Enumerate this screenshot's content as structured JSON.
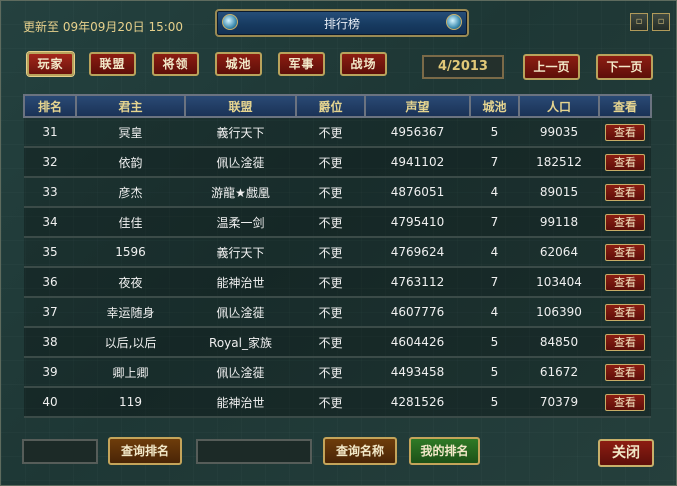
{
  "header": {
    "updated": "更新至 09年09月20日 15:00",
    "title": "排行榜"
  },
  "tabs": [
    {
      "label": "玩家"
    },
    {
      "label": "联盟"
    },
    {
      "label": "将领"
    },
    {
      "label": "城池"
    },
    {
      "label": "军事"
    },
    {
      "label": "战场"
    }
  ],
  "pagination": {
    "indicator": "4/2013",
    "prev_label": "上一页",
    "next_label": "下一页"
  },
  "table": {
    "columns": [
      "排名",
      "君主",
      "联盟",
      "爵位",
      "声望",
      "城池",
      "人口",
      "查看"
    ],
    "rows": [
      {
        "rank": "31",
        "lord": "冥皇",
        "alliance": "義行天下",
        "title": "不更",
        "prestige": "4956367",
        "cities": "5",
        "population": "99035",
        "view": "查看"
      },
      {
        "rank": "32",
        "lord": "依韵",
        "alliance": "佩亾淦蓰",
        "title": "不更",
        "prestige": "4941102",
        "cities": "7",
        "population": "182512",
        "view": "查看"
      },
      {
        "rank": "33",
        "lord": "彦杰",
        "alliance": "游龍★戲凰",
        "title": "不更",
        "prestige": "4876051",
        "cities": "4",
        "population": "89015",
        "view": "查看"
      },
      {
        "rank": "34",
        "lord": "佳佳",
        "alliance": "温柔一剑",
        "title": "不更",
        "prestige": "4795410",
        "cities": "7",
        "population": "99118",
        "view": "查看"
      },
      {
        "rank": "35",
        "lord": "1596",
        "alliance": "義行天下",
        "title": "不更",
        "prestige": "4769624",
        "cities": "4",
        "population": "62064",
        "view": "查看"
      },
      {
        "rank": "36",
        "lord": "夜夜",
        "alliance": "能神治世",
        "title": "不更",
        "prestige": "4763112",
        "cities": "7",
        "population": "103404",
        "view": "查看"
      },
      {
        "rank": "37",
        "lord": "幸运随身",
        "alliance": "佩亾淦蓰",
        "title": "不更",
        "prestige": "4607776",
        "cities": "4",
        "population": "106390",
        "view": "查看"
      },
      {
        "rank": "38",
        "lord": "以后,以后",
        "alliance": "Royal_家族",
        "title": "不更",
        "prestige": "4604426",
        "cities": "5",
        "population": "84850",
        "view": "查看"
      },
      {
        "rank": "39",
        "lord": "卿上卿",
        "alliance": "佩亾淦蓰",
        "title": "不更",
        "prestige": "4493458",
        "cities": "5",
        "population": "61672",
        "view": "查看"
      },
      {
        "rank": "40",
        "lord": "119",
        "alliance": "能神治世",
        "title": "不更",
        "prestige": "4281526",
        "cities": "5",
        "population": "70379",
        "view": "查看"
      }
    ]
  },
  "footer": {
    "query_rank_label": "查询排名",
    "query_name_label": "查询名称",
    "my_rank_label": "我的排名",
    "close_label": "关闭"
  }
}
